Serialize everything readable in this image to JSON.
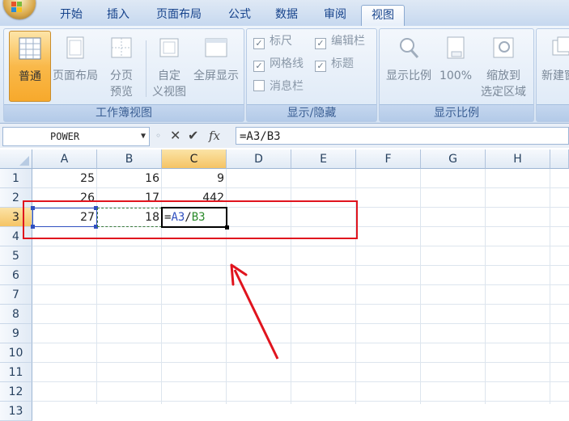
{
  "tabs": [
    "开始",
    "插入",
    "页面布局",
    "公式",
    "数据",
    "审阅",
    "视图"
  ],
  "active_tab": "视图",
  "ribbon": {
    "workbook_views": {
      "label": "工作簿视图",
      "buttons": [
        {
          "label": "普通",
          "icon": "normal-view-icon"
        },
        {
          "label": "页面布局",
          "icon": "page-layout-icon"
        },
        {
          "label1": "分页",
          "label2": "预览",
          "icon": "page-break-preview-icon"
        },
        {
          "label1": "自定",
          "label2": "义视图",
          "icon": "custom-views-icon"
        },
        {
          "label": "全屏显示",
          "icon": "full-screen-icon"
        }
      ]
    },
    "show_hide": {
      "label": "显示/隐藏",
      "items": [
        {
          "label": "标尺",
          "checked": true
        },
        {
          "label": "编辑栏",
          "checked": true
        },
        {
          "label": "网格线",
          "checked": true
        },
        {
          "label": "标题",
          "checked": true
        },
        {
          "label": "消息栏",
          "checked": false
        }
      ]
    },
    "zoom": {
      "label": "显示比例",
      "buttons": [
        {
          "label": "显示比例",
          "icon": "zoom-icon"
        },
        {
          "label": "100%",
          "icon": "zoom-100-icon"
        },
        {
          "label1": "缩放到",
          "label2": "选定区域",
          "icon": "zoom-selection-icon"
        }
      ]
    },
    "window": {
      "buttons": [
        {
          "label": "新建窗",
          "icon": "new-window-icon"
        }
      ]
    }
  },
  "formula_bar": {
    "name_box": "POWER",
    "formula": "=A3/B3",
    "fx_label": "fx"
  },
  "grid": {
    "columns": [
      "A",
      "B",
      "C",
      "D",
      "E",
      "F",
      "G",
      "H"
    ],
    "rows": [
      "1",
      "2",
      "3",
      "4",
      "5",
      "6",
      "7",
      "8",
      "9",
      "10",
      "11",
      "12",
      "13"
    ],
    "cells": {
      "A1": "25",
      "B1": "16",
      "C1": "9",
      "A2": "26",
      "B2": "17",
      "C2": "442",
      "A3": "27",
      "B3": "18"
    },
    "editing_cell": "C3",
    "editing_text": {
      "eq": "=",
      "a": "A3",
      "slash": "/",
      "b": "B3"
    }
  },
  "colors": {
    "ref_a3": "#3050c0",
    "ref_b3": "#2a8a2a",
    "annotation": "#e0141e"
  }
}
